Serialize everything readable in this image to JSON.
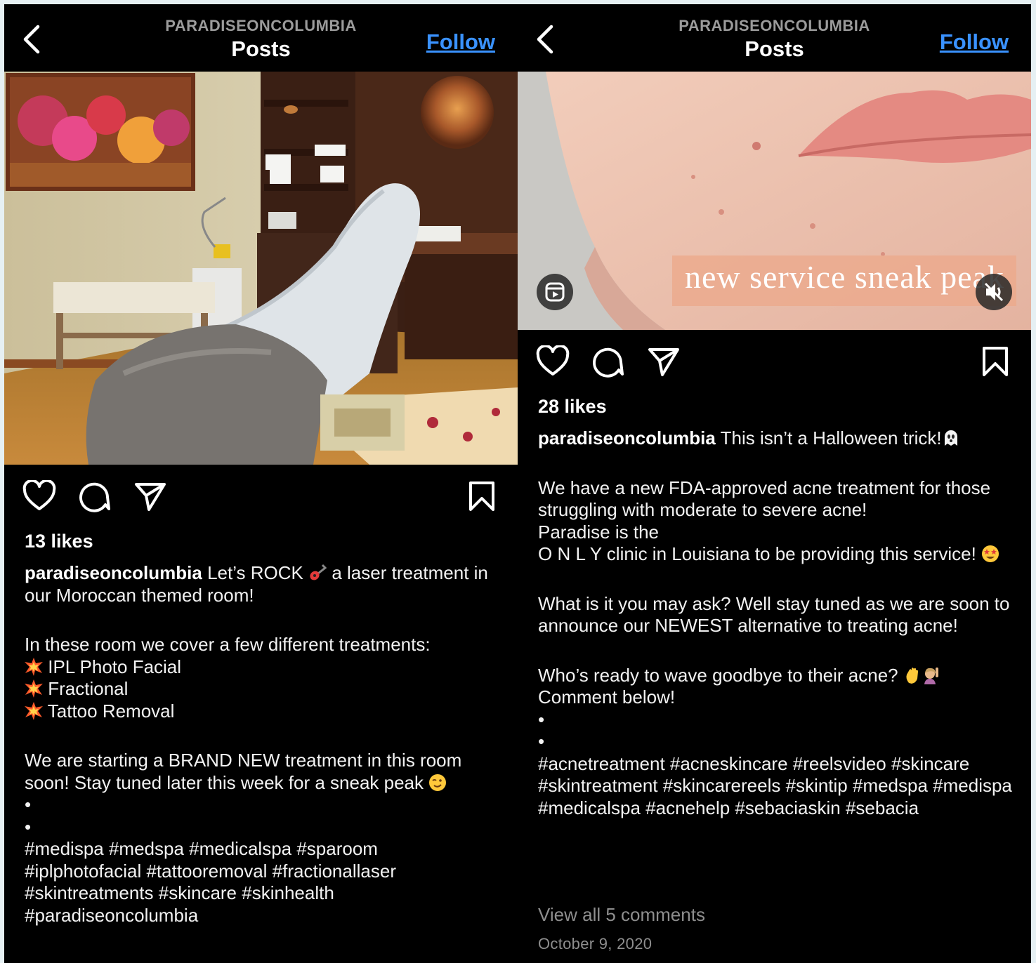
{
  "colors": {
    "accent_link": "#3a92ff",
    "muted_text": "#8e8e8e",
    "background": "#000000",
    "frame": "#e6f0f3"
  },
  "left": {
    "header": {
      "account": "PARADISEONCOLUMBIA",
      "title": "Posts",
      "follow": "Follow"
    },
    "likes": "13 likes",
    "caption": {
      "username": "paradiseoncolumbia",
      "line1a": "Let’s ROCK",
      "line1b": "a laser treatment in our Moroccan themed room!",
      "p2": "In these room we cover a few different treatments:",
      "items": [
        "IPL Photo Facial",
        "Fractional",
        "Tattoo Removal"
      ],
      "p3": "We are starting a BRAND NEW treatment in this room soon! Stay tuned later this week for a sneak peak",
      "dot1": "•",
      "dot2": "•",
      "hashtags": "#medispa #medspa #medicalspa #sparoom #iplphotofacial #tattooremoval #fractionallaser #skintreatments #skincare #skinhealth #paradiseoncolumbia"
    },
    "icons": [
      "heart-icon",
      "comment-icon",
      "share-icon",
      "bookmark-icon",
      "guitar-emoji",
      "collision-emoji",
      "wink-emoji"
    ]
  },
  "right": {
    "header": {
      "account": "PARADISEONCOLUMBIA",
      "title": "Posts",
      "follow": "Follow"
    },
    "video_overlay": "new service sneak peak",
    "likes": "28 likes",
    "caption": {
      "username": "paradiseoncolumbia",
      "line1": "This isn’t a Halloween trick!",
      "p2a": "We have a new FDA-approved acne treatment for those struggling with moderate to severe acne!",
      "p2b": "Paradise is the",
      "p2c": "O N L Y clinic in Louisiana to be providing this service!",
      "p3": "What is it you may ask? Well stay tuned as we are soon to announce our NEWEST alternative to treating acne!",
      "p4a": "Who’s ready to wave goodbye to their acne?",
      "p4b": "Comment below!",
      "dot1": "•",
      "dot2": "•",
      "hashtags": "#acnetreatment #acneskincare #reelsvideo #skincare #skintreatment #skincarereels #skintip #medspa #medispa #medicalspa #acnehelp #sebaciaskin #sebacia"
    },
    "comments": "View all 5 comments",
    "date": "October 9, 2020",
    "icons": [
      "heart-icon",
      "comment-icon",
      "share-icon",
      "bookmark-icon",
      "reel-icon",
      "mute-icon",
      "ghost-emoji",
      "star-struck-emoji",
      "waving-hand-emoji",
      "person-raising-hand-emoji"
    ]
  }
}
